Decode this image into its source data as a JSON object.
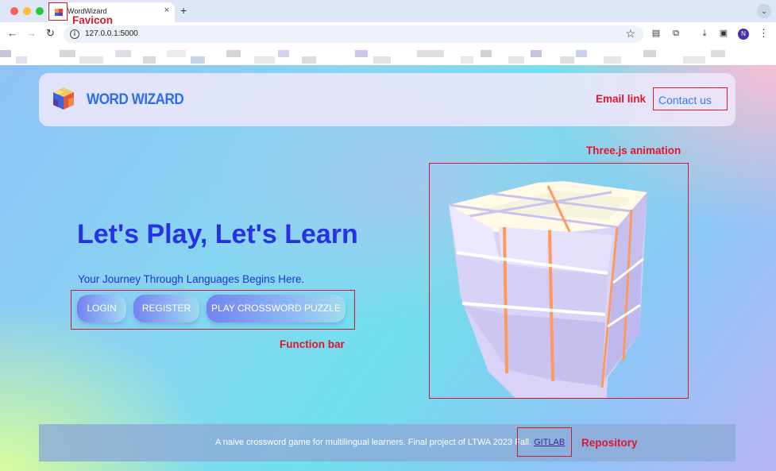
{
  "browser": {
    "tab_title": "WordWizard",
    "url": "127.0.0.1:5000",
    "avatar_initial": "N"
  },
  "header": {
    "brand": "WORD WIZARD",
    "contact_label": "Contact us"
  },
  "hero": {
    "title": "Let's Play, Let's Learn",
    "subtitle": "Your Journey Through Languages Begins Here.",
    "buttons": {
      "login": "LOGIN",
      "register": "REGISTER",
      "play": "PLAY CROSSWORD PUZZLE"
    }
  },
  "footer": {
    "text": "A naive crossword game for multilingual learners. Final project of LTWA 2023 Fall.",
    "link_label": "GITLAB"
  },
  "annotations": {
    "favicon": "Favicon",
    "email_link": "Email link",
    "threejs": "Three.js animation",
    "function_bar": "Function bar",
    "repository": "Repository"
  },
  "colors": {
    "brand": "#2f6df0",
    "hero_title": "#2532e6",
    "annotation": "#e0162b"
  }
}
